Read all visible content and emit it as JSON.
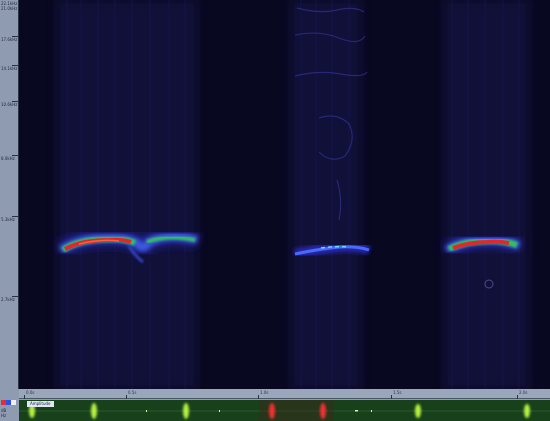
{
  "freq_axis": {
    "labels": [
      "22.1kHz",
      "21.0kHz",
      "17.6kHz",
      "14.1kHz",
      "10.6kHz",
      "8.0kHz",
      "5.3kHz",
      "2.7kHz"
    ]
  },
  "time_axis": {
    "labels": [
      "0.0s",
      "0.5s",
      "1.0s",
      "1.5s",
      "2.0s"
    ]
  },
  "waveform": {
    "tag": "Amplitude"
  },
  "legend": {
    "labels": [
      "dB",
      "Hz"
    ],
    "colors": [
      "#e03030",
      "#3050e0",
      "#f0f0f0"
    ]
  },
  "palette": {
    "background": "#090821",
    "low": "#2a2ab0",
    "mid": "#30d050",
    "high": "#e02828",
    "waveform_bg": "#17401b",
    "waveform_green": "#b8f040",
    "waveform_red": "#f03030"
  }
}
